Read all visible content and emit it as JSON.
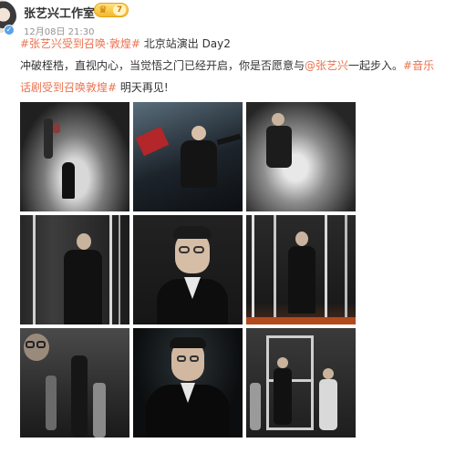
{
  "post": {
    "author": "张艺兴工作室",
    "badge_level": "7",
    "time": "12月08日 21:30",
    "line1": [
      {
        "text": "#张艺兴受到召唤·敦煌#",
        "kind": "link"
      },
      {
        "text": " 北京站演出 Day2",
        "kind": "plain"
      }
    ],
    "line2": [
      {
        "text": "冲破桎梏，直视内心，当觉悟之门已经开启，你是否愿意与",
        "kind": "plain"
      },
      {
        "text": "@张艺兴",
        "kind": "link"
      },
      {
        "text": "一起步入。",
        "kind": "plain"
      },
      {
        "text": "#音乐",
        "kind": "link"
      }
    ],
    "line3": [
      {
        "text": "话剧受到召唤敦煌#",
        "kind": "link"
      },
      {
        "text": " 明天再见!",
        "kind": "plain"
      }
    ]
  },
  "photos": [
    {
      "name": "photo-1",
      "alt": "stage smoke"
    },
    {
      "name": "photo-2",
      "alt": "dancers with red fabric"
    },
    {
      "name": "photo-3",
      "alt": "performer in smoke"
    },
    {
      "name": "photo-4",
      "alt": "performer with light bars"
    },
    {
      "name": "photo-5",
      "alt": "close-up with glasses"
    },
    {
      "name": "photo-6",
      "alt": "light cage"
    },
    {
      "name": "photo-7",
      "alt": "cast on stage"
    },
    {
      "name": "photo-8",
      "alt": "close-up in black"
    },
    {
      "name": "photo-9",
      "alt": "frame set"
    }
  ],
  "icons": {
    "verified": "verified-check-icon",
    "badge": "crown-icon"
  },
  "colors": {
    "link": "#eb7350",
    "badge": "#f3b72d",
    "verified": "#5aa2e8"
  }
}
